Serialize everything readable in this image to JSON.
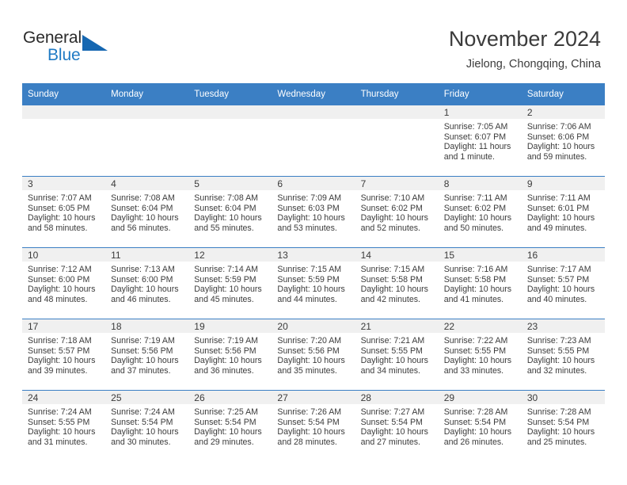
{
  "logo": {
    "word_one": "General",
    "word_two": "Blue",
    "triangle_color": "#1667b1",
    "blue_color": "#1f7ac4"
  },
  "header": {
    "title": "November 2024",
    "location": "Jielong, Chongqing, China"
  },
  "theme": {
    "header_blue": "#3b7fc4",
    "daynum_band": "#f0f0f0",
    "text": "#3b3b3b"
  },
  "weekdays": [
    "Sunday",
    "Monday",
    "Tuesday",
    "Wednesday",
    "Thursday",
    "Friday",
    "Saturday"
  ],
  "weeks": [
    [
      {
        "empty": true
      },
      {
        "empty": true
      },
      {
        "empty": true
      },
      {
        "empty": true
      },
      {
        "empty": true
      },
      {
        "day": "1",
        "sunrise": "Sunrise: 7:05 AM",
        "sunset": "Sunset: 6:07 PM",
        "daylight": "Daylight: 11 hours and 1 minute."
      },
      {
        "day": "2",
        "sunrise": "Sunrise: 7:06 AM",
        "sunset": "Sunset: 6:06 PM",
        "daylight": "Daylight: 10 hours and 59 minutes."
      }
    ],
    [
      {
        "day": "3",
        "sunrise": "Sunrise: 7:07 AM",
        "sunset": "Sunset: 6:05 PM",
        "daylight": "Daylight: 10 hours and 58 minutes."
      },
      {
        "day": "4",
        "sunrise": "Sunrise: 7:08 AM",
        "sunset": "Sunset: 6:04 PM",
        "daylight": "Daylight: 10 hours and 56 minutes."
      },
      {
        "day": "5",
        "sunrise": "Sunrise: 7:08 AM",
        "sunset": "Sunset: 6:04 PM",
        "daylight": "Daylight: 10 hours and 55 minutes."
      },
      {
        "day": "6",
        "sunrise": "Sunrise: 7:09 AM",
        "sunset": "Sunset: 6:03 PM",
        "daylight": "Daylight: 10 hours and 53 minutes."
      },
      {
        "day": "7",
        "sunrise": "Sunrise: 7:10 AM",
        "sunset": "Sunset: 6:02 PM",
        "daylight": "Daylight: 10 hours and 52 minutes."
      },
      {
        "day": "8",
        "sunrise": "Sunrise: 7:11 AM",
        "sunset": "Sunset: 6:02 PM",
        "daylight": "Daylight: 10 hours and 50 minutes."
      },
      {
        "day": "9",
        "sunrise": "Sunrise: 7:11 AM",
        "sunset": "Sunset: 6:01 PM",
        "daylight": "Daylight: 10 hours and 49 minutes."
      }
    ],
    [
      {
        "day": "10",
        "sunrise": "Sunrise: 7:12 AM",
        "sunset": "Sunset: 6:00 PM",
        "daylight": "Daylight: 10 hours and 48 minutes."
      },
      {
        "day": "11",
        "sunrise": "Sunrise: 7:13 AM",
        "sunset": "Sunset: 6:00 PM",
        "daylight": "Daylight: 10 hours and 46 minutes."
      },
      {
        "day": "12",
        "sunrise": "Sunrise: 7:14 AM",
        "sunset": "Sunset: 5:59 PM",
        "daylight": "Daylight: 10 hours and 45 minutes."
      },
      {
        "day": "13",
        "sunrise": "Sunrise: 7:15 AM",
        "sunset": "Sunset: 5:59 PM",
        "daylight": "Daylight: 10 hours and 44 minutes."
      },
      {
        "day": "14",
        "sunrise": "Sunrise: 7:15 AM",
        "sunset": "Sunset: 5:58 PM",
        "daylight": "Daylight: 10 hours and 42 minutes."
      },
      {
        "day": "15",
        "sunrise": "Sunrise: 7:16 AM",
        "sunset": "Sunset: 5:58 PM",
        "daylight": "Daylight: 10 hours and 41 minutes."
      },
      {
        "day": "16",
        "sunrise": "Sunrise: 7:17 AM",
        "sunset": "Sunset: 5:57 PM",
        "daylight": "Daylight: 10 hours and 40 minutes."
      }
    ],
    [
      {
        "day": "17",
        "sunrise": "Sunrise: 7:18 AM",
        "sunset": "Sunset: 5:57 PM",
        "daylight": "Daylight: 10 hours and 39 minutes."
      },
      {
        "day": "18",
        "sunrise": "Sunrise: 7:19 AM",
        "sunset": "Sunset: 5:56 PM",
        "daylight": "Daylight: 10 hours and 37 minutes."
      },
      {
        "day": "19",
        "sunrise": "Sunrise: 7:19 AM",
        "sunset": "Sunset: 5:56 PM",
        "daylight": "Daylight: 10 hours and 36 minutes."
      },
      {
        "day": "20",
        "sunrise": "Sunrise: 7:20 AM",
        "sunset": "Sunset: 5:56 PM",
        "daylight": "Daylight: 10 hours and 35 minutes."
      },
      {
        "day": "21",
        "sunrise": "Sunrise: 7:21 AM",
        "sunset": "Sunset: 5:55 PM",
        "daylight": "Daylight: 10 hours and 34 minutes."
      },
      {
        "day": "22",
        "sunrise": "Sunrise: 7:22 AM",
        "sunset": "Sunset: 5:55 PM",
        "daylight": "Daylight: 10 hours and 33 minutes."
      },
      {
        "day": "23",
        "sunrise": "Sunrise: 7:23 AM",
        "sunset": "Sunset: 5:55 PM",
        "daylight": "Daylight: 10 hours and 32 minutes."
      }
    ],
    [
      {
        "day": "24",
        "sunrise": "Sunrise: 7:24 AM",
        "sunset": "Sunset: 5:55 PM",
        "daylight": "Daylight: 10 hours and 31 minutes."
      },
      {
        "day": "25",
        "sunrise": "Sunrise: 7:24 AM",
        "sunset": "Sunset: 5:54 PM",
        "daylight": "Daylight: 10 hours and 30 minutes."
      },
      {
        "day": "26",
        "sunrise": "Sunrise: 7:25 AM",
        "sunset": "Sunset: 5:54 PM",
        "daylight": "Daylight: 10 hours and 29 minutes."
      },
      {
        "day": "27",
        "sunrise": "Sunrise: 7:26 AM",
        "sunset": "Sunset: 5:54 PM",
        "daylight": "Daylight: 10 hours and 28 minutes."
      },
      {
        "day": "28",
        "sunrise": "Sunrise: 7:27 AM",
        "sunset": "Sunset: 5:54 PM",
        "daylight": "Daylight: 10 hours and 27 minutes."
      },
      {
        "day": "29",
        "sunrise": "Sunrise: 7:28 AM",
        "sunset": "Sunset: 5:54 PM",
        "daylight": "Daylight: 10 hours and 26 minutes."
      },
      {
        "day": "30",
        "sunrise": "Sunrise: 7:28 AM",
        "sunset": "Sunset: 5:54 PM",
        "daylight": "Daylight: 10 hours and 25 minutes."
      }
    ]
  ]
}
